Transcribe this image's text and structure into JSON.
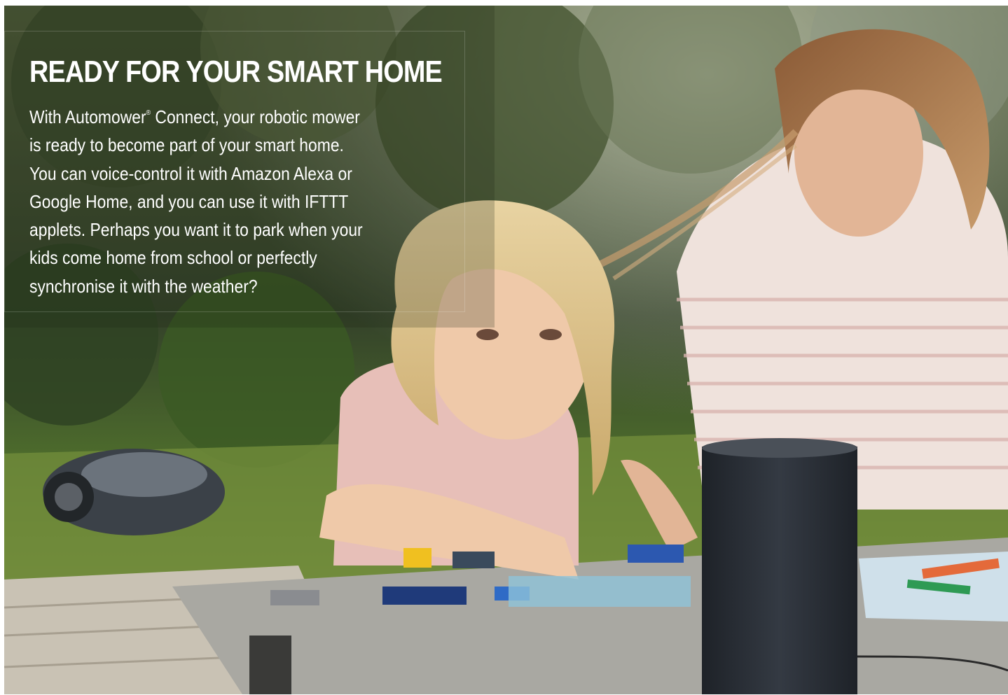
{
  "headline": "READY FOR YOUR SMART HOME",
  "body": {
    "line1_before": "With Automower",
    "registered_mark": "®",
    "line1_after": " Connect, your robotic mower",
    "line2": "is ready to become part of your smart home.",
    "line3": "You can voice-control it with Amazon Alexa or",
    "line4": "Google Home, and you can use it with IFTTT",
    "line5": "applets. Perhaps you want it to park when your",
    "line6": "kids come home from school or perfectly",
    "line7": "synchronise it with the weather?"
  },
  "colors": {
    "text": "#ffffff",
    "foliage": "#3d4a2e",
    "lawn": "#6f8a3a",
    "table": "#a9a8a2",
    "speaker": "#2b2f36"
  }
}
